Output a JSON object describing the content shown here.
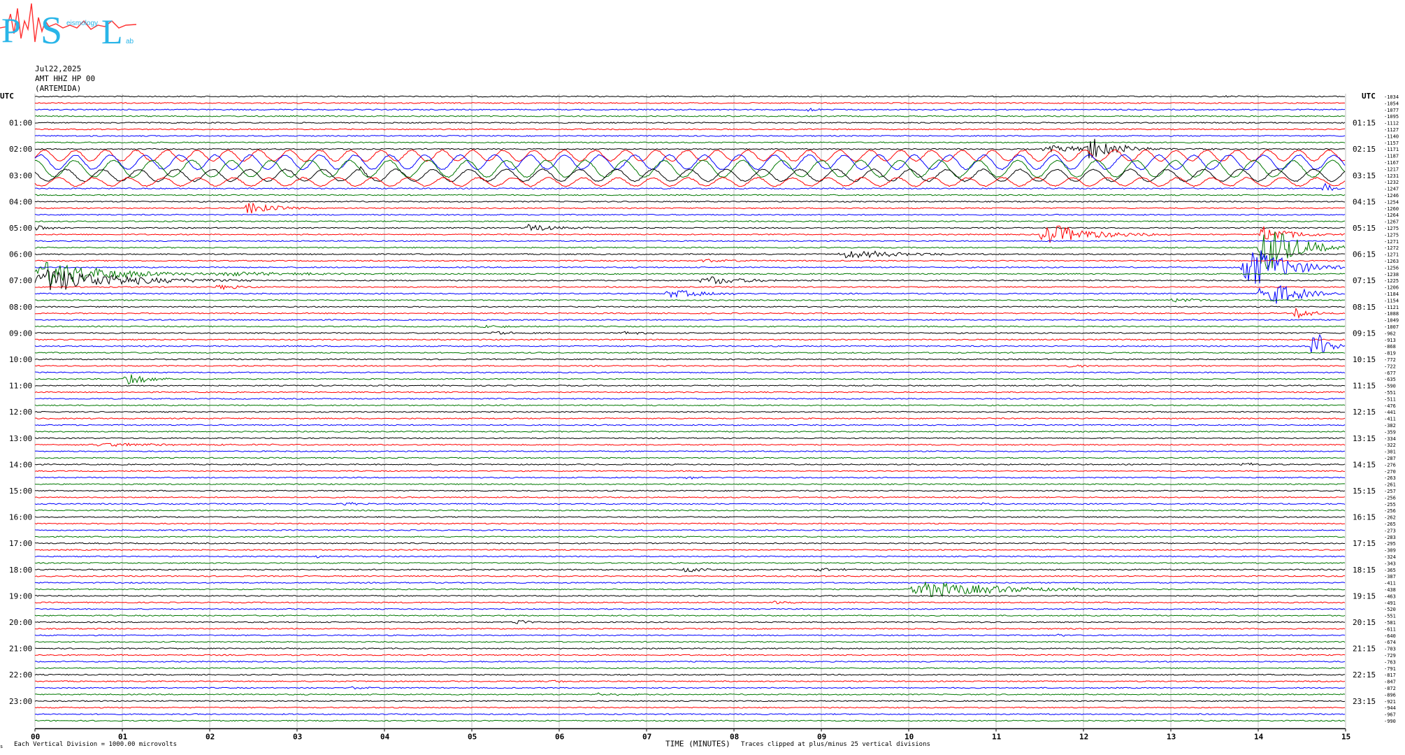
{
  "logo": {
    "letters": [
      "P",
      "S",
      "L"
    ],
    "small_words": [
      "eismology",
      "ab"
    ]
  },
  "header": {
    "date": "Jul22,2025",
    "station": "AMT HHZ HP 00",
    "station_name": "(ARTEMIDA)"
  },
  "axes": {
    "left_label": "UTC",
    "right_label": "UTC",
    "x_title": "TIME (MINUTES)",
    "scale_note": "Each Vertical Division = 1000.00 microvolts",
    "clip_note": "Traces clipped at plus/minus 25 vertical divisions",
    "corner_note": "s"
  },
  "colors": {
    "cycle": [
      "#000000",
      "#ff0000",
      "#0000ff",
      "#007700"
    ],
    "grid": "#c0c0c0"
  },
  "chart_data": {
    "type": "line",
    "title": "",
    "xlabel": "TIME (MINUTES)",
    "ylabel": "UTC",
    "x_ticks": [
      "00",
      "01",
      "02",
      "03",
      "04",
      "05",
      "06",
      "07",
      "08",
      "09",
      "10",
      "11",
      "12",
      "13",
      "14",
      "15"
    ],
    "xlim": [
      0,
      15
    ],
    "grid": true,
    "left_hour_labels": [
      "01:00",
      "02:00",
      "03:00",
      "04:00",
      "05:00",
      "06:00",
      "07:00",
      "08:00",
      "09:00",
      "10:00",
      "11:00",
      "12:00",
      "13:00",
      "14:00",
      "15:00",
      "16:00",
      "17:00",
      "18:00",
      "19:00",
      "20:00",
      "21:00",
      "22:00",
      "23:00"
    ],
    "right_hour_labels": [
      "01:15",
      "02:15",
      "03:15",
      "04:15",
      "05:15",
      "06:15",
      "07:15",
      "08:15",
      "09:15",
      "10:15",
      "11:15",
      "12:15",
      "13:15",
      "14:15",
      "15:15",
      "16:15",
      "17:15",
      "18:15",
      "19:15",
      "20:15",
      "21:15",
      "22:15",
      "23:15"
    ],
    "trace_count": 96,
    "trace_minutes": 15,
    "offsets": [
      "-1034",
      "-1054",
      "-1077",
      "-1095",
      "-1112",
      "-1127",
      "-1140",
      "-1157",
      "-1171",
      "-1187",
      "-1167",
      "-1217",
      "-1231",
      "-1232",
      "-1247",
      "-1246",
      "-1254",
      "-1260",
      "-1264",
      "-1267",
      "-1275",
      "-1275",
      "-1271",
      "-1272",
      "-1271",
      "-1263",
      "-1256",
      "-1238",
      "-1225",
      "-1206",
      "-1184",
      "-1154",
      "-1121",
      "-1088",
      "-1049",
      "-1007",
      "-962",
      "-913",
      "-868",
      "-819",
      "-772",
      "-722",
      "-677",
      "-635",
      "-590",
      "-551",
      "-511",
      "-476",
      "-441",
      "-411",
      "-382",
      "-359",
      "-334",
      "-322",
      "-301",
      "-287",
      "-276",
      "-270",
      "-263",
      "-261",
      "-257",
      "-256",
      "-255",
      "-256",
      "-262",
      "-265",
      "-273",
      "-283",
      "-295",
      "-309",
      "-324",
      "-343",
      "-365",
      "-387",
      "-411",
      "-438",
      "-463",
      "-491",
      "-520",
      "-551",
      "-581",
      "-611",
      "-640",
      "-674",
      "-703",
      "-729",
      "-763",
      "-791",
      "-817",
      "-847",
      "-872",
      "-896",
      "-921",
      "-944",
      "-967",
      "-990"
    ],
    "events": [
      {
        "trace": 0,
        "start": 13.6,
        "dur": 0.3,
        "amp": 0.5
      },
      {
        "trace": 2,
        "start": 8.8,
        "dur": 0.4,
        "amp": 0.7
      },
      {
        "trace": 8,
        "start": 12.0,
        "dur": 0.8,
        "amp": 4.5
      },
      {
        "trace": 8,
        "start": 11.5,
        "dur": 2.5,
        "amp": 1.2
      },
      {
        "trace": 9,
        "start": 0.0,
        "dur": 15.0,
        "amp": 1.8,
        "period": 0.35
      },
      {
        "trace": 10,
        "start": 0.0,
        "dur": 15.0,
        "amp": 2.4,
        "period": 0.4
      },
      {
        "trace": 11,
        "start": 0.0,
        "dur": 15.0,
        "amp": 2.8,
        "period": 0.45
      },
      {
        "trace": 12,
        "start": 0.0,
        "dur": 15.0,
        "amp": 2.0,
        "period": 0.42
      },
      {
        "trace": 13,
        "start": 0.0,
        "dur": 15.0,
        "amp": 1.4,
        "period": 0.4
      },
      {
        "trace": 14,
        "start": 14.7,
        "dur": 0.3,
        "amp": 3.0
      },
      {
        "trace": 12,
        "start": 3.7,
        "dur": 0.3,
        "amp": 1.8
      },
      {
        "trace": 17,
        "start": 2.4,
        "dur": 0.8,
        "amp": 2.5
      },
      {
        "trace": 20,
        "start": 0.0,
        "dur": 0.4,
        "amp": 1.2
      },
      {
        "trace": 20,
        "start": 5.6,
        "dur": 0.9,
        "amp": 1.6
      },
      {
        "trace": 21,
        "start": 11.5,
        "dur": 1.5,
        "amp": 4.0
      },
      {
        "trace": 21,
        "start": 14.0,
        "dur": 1.0,
        "amp": 3.0
      },
      {
        "trace": 23,
        "start": 14.0,
        "dur": 1.0,
        "amp": 10.0
      },
      {
        "trace": 24,
        "start": 9.2,
        "dur": 1.8,
        "amp": 1.6
      },
      {
        "trace": 25,
        "start": 7.6,
        "dur": 1.1,
        "amp": 0.6
      },
      {
        "trace": 26,
        "start": 13.8,
        "dur": 1.2,
        "amp": 9.0
      },
      {
        "trace": 27,
        "start": 0.0,
        "dur": 2.0,
        "amp": 5.0
      },
      {
        "trace": 27,
        "start": 2.0,
        "dur": 3.0,
        "amp": 0.9
      },
      {
        "trace": 28,
        "start": 0.0,
        "dur": 2.5,
        "amp": 4.5
      },
      {
        "trace": 28,
        "start": 7.6,
        "dur": 1.5,
        "amp": 1.6
      },
      {
        "trace": 29,
        "start": 2.0,
        "dur": 1.0,
        "amp": 0.9
      },
      {
        "trace": 30,
        "start": 7.2,
        "dur": 1.3,
        "amp": 1.5
      },
      {
        "trace": 30,
        "start": 14.0,
        "dur": 1.0,
        "amp": 6.0
      },
      {
        "trace": 31,
        "start": 13.0,
        "dur": 0.9,
        "amp": 0.9
      },
      {
        "trace": 33,
        "start": 14.4,
        "dur": 0.6,
        "amp": 2.0
      },
      {
        "trace": 35,
        "start": 5.1,
        "dur": 0.9,
        "amp": 0.7
      },
      {
        "trace": 36,
        "start": 5.2,
        "dur": 0.8,
        "amp": 0.7
      },
      {
        "trace": 36,
        "start": 6.7,
        "dur": 0.7,
        "amp": 0.6
      },
      {
        "trace": 38,
        "start": 14.6,
        "dur": 0.4,
        "amp": 8.0
      },
      {
        "trace": 41,
        "start": 11.8,
        "dur": 0.7,
        "amp": 0.6
      },
      {
        "trace": 43,
        "start": 1.0,
        "dur": 0.8,
        "amp": 2.4
      },
      {
        "trace": 45,
        "start": 4.7,
        "dur": 0.1,
        "amp": 0.3
      },
      {
        "trace": 53,
        "start": 0.6,
        "dur": 3.5,
        "amp": 0.6
      },
      {
        "trace": 56,
        "start": 13.8,
        "dur": 0.5,
        "amp": 0.9
      },
      {
        "trace": 58,
        "start": 7.4,
        "dur": 0.6,
        "amp": 0.6
      },
      {
        "trace": 62,
        "start": 3.5,
        "dur": 0.5,
        "amp": 0.7
      },
      {
        "trace": 62,
        "start": 10.8,
        "dur": 0.6,
        "amp": 0.5
      },
      {
        "trace": 70,
        "start": 3.2,
        "dur": 0.5,
        "amp": 0.5
      },
      {
        "trace": 72,
        "start": 7.4,
        "dur": 0.8,
        "amp": 0.9
      },
      {
        "trace": 72,
        "start": 8.9,
        "dur": 1.0,
        "amp": 0.5
      },
      {
        "trace": 75,
        "start": 10.0,
        "dur": 2.8,
        "amp": 3.0
      },
      {
        "trace": 77,
        "start": 8.4,
        "dur": 0.7,
        "amp": 0.6
      },
      {
        "trace": 80,
        "start": 5.5,
        "dur": 0.3,
        "amp": 1.4
      },
      {
        "trace": 82,
        "start": 11.7,
        "dur": 0.2,
        "amp": 0.8
      },
      {
        "trace": 89,
        "start": 5.9,
        "dur": 0.7,
        "amp": 0.5
      },
      {
        "trace": 90,
        "start": 3.6,
        "dur": 0.7,
        "amp": 0.5
      },
      {
        "trace": 91,
        "start": 6.4,
        "dur": 0.7,
        "amp": 0.5
      }
    ]
  }
}
